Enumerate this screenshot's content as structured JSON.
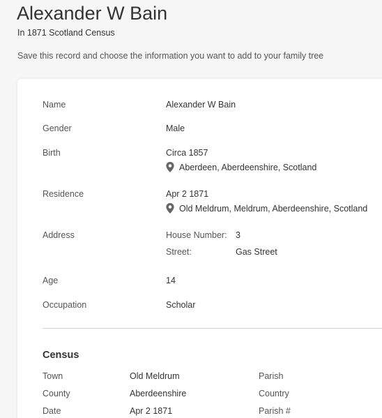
{
  "header": {
    "title": "Alexander W Bain",
    "subtitle": "In 1871 Scotland Census",
    "intro": "Save this record and choose the information you want to add to your family tree"
  },
  "record": {
    "name_label": "Name",
    "name_value": "Alexander W Bain",
    "gender_label": "Gender",
    "gender_value": "Male",
    "birth_label": "Birth",
    "birth_date": "Circa 1857",
    "birth_place": "Aberdeen, Aberdeenshire, Scotland",
    "residence_label": "Residence",
    "residence_date": "Apr 2 1871",
    "residence_place": "Old Meldrum, Meldrum, Aberdeenshire, Scotland",
    "address_label": "Address",
    "house_number_label": "House Number:",
    "house_number_value": "3",
    "street_label": "Street:",
    "street_value": "Gas Street",
    "age_label": "Age",
    "age_value": "14",
    "occupation_label": "Occupation",
    "occupation_value": "Scholar"
  },
  "census": {
    "section_title": "Census",
    "town_label": "Town",
    "town_value": "Old Meldrum",
    "parish_label": "Parish",
    "county_label": "County",
    "county_value": "Aberdeenshire",
    "country_label": "Country",
    "date_label": "Date",
    "date_value": "Apr 2 1871",
    "parish_num_label": "Parish #"
  },
  "icons": {
    "location": "location-pin-icon"
  },
  "colors": {
    "pin": "#666666",
    "divider": "#d4d4d4"
  }
}
